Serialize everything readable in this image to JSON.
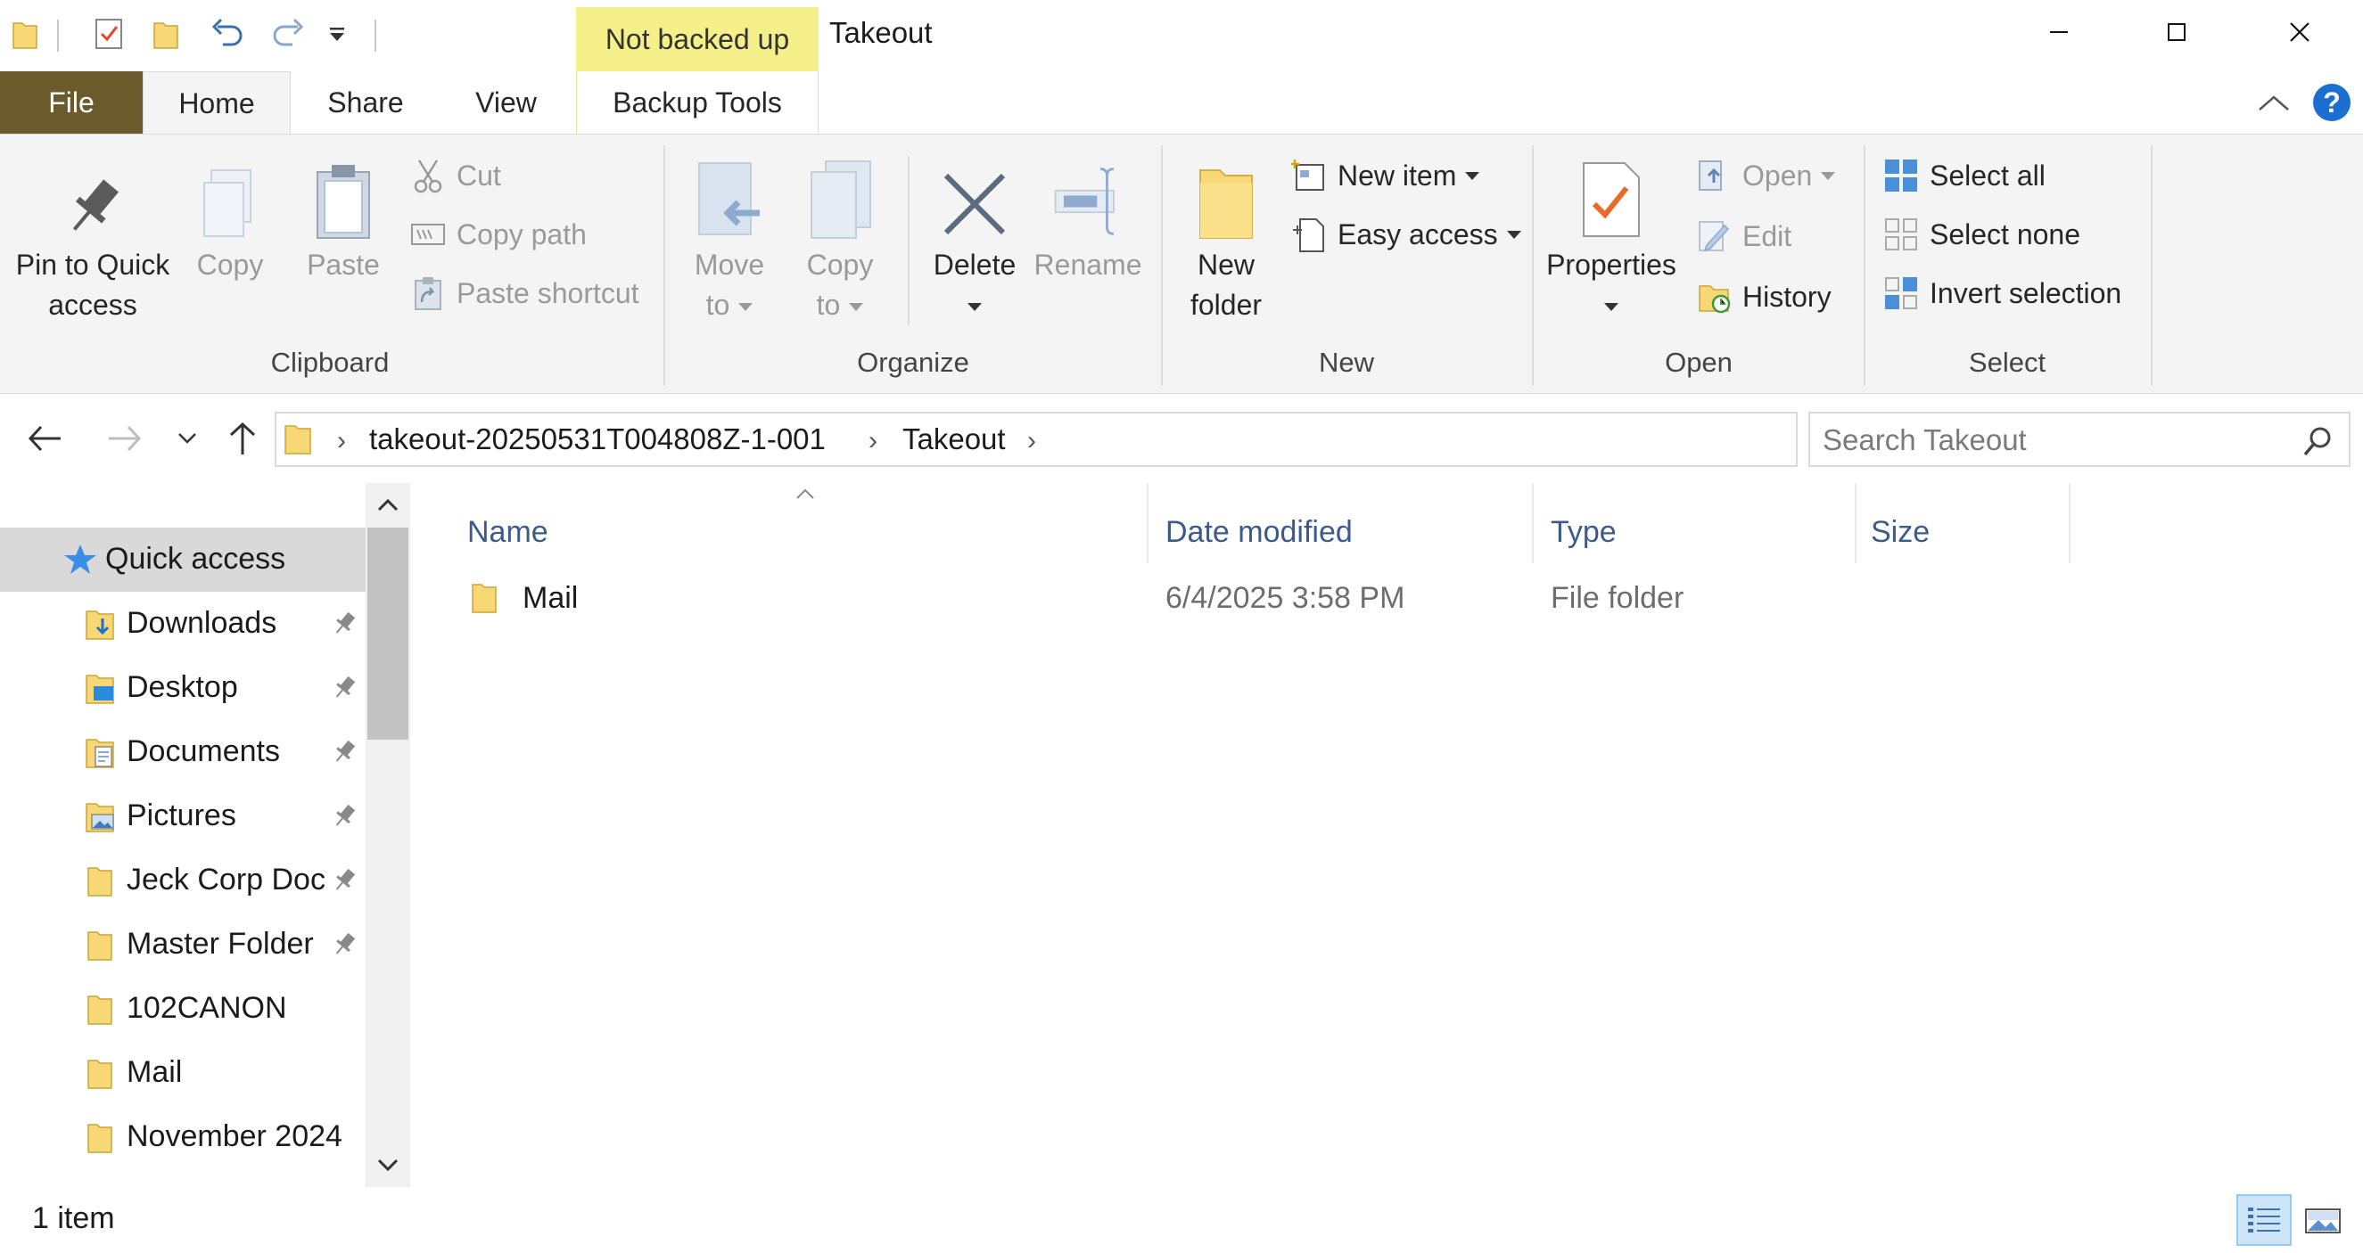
{
  "window": {
    "title": "Takeout",
    "context_tab_header": "Not backed up",
    "buttons": [
      "minimize",
      "maximize",
      "close"
    ]
  },
  "quick_access_toolbar": {
    "icons": [
      "folder-icon",
      "properties-check-icon",
      "new-folder-icon",
      "undo-icon",
      "redo-icon",
      "customize-dropdown-icon"
    ]
  },
  "tabs": {
    "file": "File",
    "home": "Home",
    "share": "Share",
    "view": "View",
    "backup_tools": "Backup Tools",
    "active": "Home"
  },
  "ribbon": {
    "clipboard": {
      "label": "Clipboard",
      "pin_line1": "Pin to Quick",
      "pin_line2": "access",
      "copy": "Copy",
      "paste": "Paste",
      "cut": "Cut",
      "copy_path": "Copy path",
      "paste_shortcut": "Paste shortcut"
    },
    "organize": {
      "label": "Organize",
      "move_line1": "Move",
      "move_line2": "to",
      "copy_line1": "Copy",
      "copy_line2": "to",
      "delete": "Delete",
      "rename": "Rename"
    },
    "new": {
      "label": "New",
      "new_folder_line1": "New",
      "new_folder_line2": "folder",
      "new_item": "New item",
      "easy_access": "Easy access"
    },
    "open": {
      "label": "Open",
      "properties": "Properties",
      "open": "Open",
      "edit": "Edit",
      "history": "History"
    },
    "select": {
      "label": "Select",
      "select_all": "Select all",
      "select_none": "Select none",
      "invert_selection": "Invert selection"
    }
  },
  "address": {
    "segments": [
      "takeout-20250531T004808Z-1-001",
      "Takeout"
    ],
    "search_placeholder": "Search Takeout"
  },
  "nav_pane": {
    "items": [
      {
        "label": "Quick access",
        "icon": "star-icon",
        "pinned": false,
        "selected": true
      },
      {
        "label": "Downloads",
        "icon": "downloads-folder-icon",
        "pinned": true
      },
      {
        "label": "Desktop",
        "icon": "desktop-folder-icon",
        "pinned": true
      },
      {
        "label": "Documents",
        "icon": "documents-folder-icon",
        "pinned": true
      },
      {
        "label": "Pictures",
        "icon": "pictures-folder-icon",
        "pinned": true
      },
      {
        "label": "Jeck Corp Doc",
        "icon": "folder-icon",
        "pinned": true
      },
      {
        "label": "Master Folder",
        "icon": "folder-icon",
        "pinned": true
      },
      {
        "label": "102CANON",
        "icon": "folder-icon",
        "pinned": false
      },
      {
        "label": "Mail",
        "icon": "folder-icon",
        "pinned": false
      },
      {
        "label": "November 2024",
        "icon": "folder-icon",
        "pinned": false
      }
    ]
  },
  "file_list": {
    "columns": [
      "Name",
      "Date modified",
      "Type",
      "Size"
    ],
    "rows": [
      {
        "name": "Mail",
        "date_modified": "6/4/2025 3:58 PM",
        "type": "File folder",
        "size": ""
      }
    ]
  },
  "status": {
    "item_count": "1 item"
  },
  "colors": {
    "file_tab": "#6b5a2c",
    "context_tab": "#f5f08a",
    "folder_yellow": "#f8d775",
    "accent_blue": "#1a6fd1",
    "column_header_text": "#3c5a8a"
  }
}
